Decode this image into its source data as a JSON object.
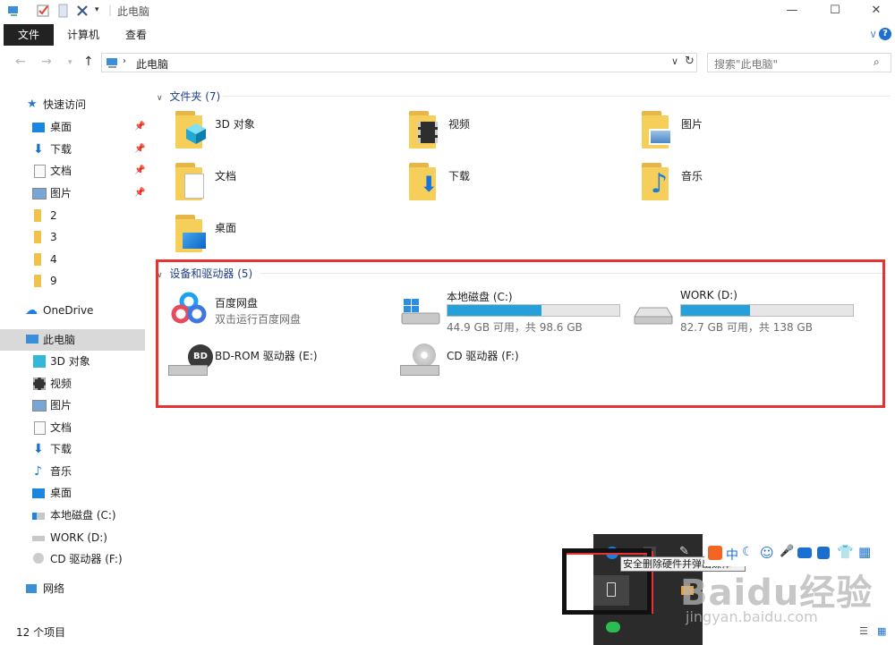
{
  "window": {
    "title": "此电脑",
    "controls": {
      "minimize": "—",
      "maximize": "☐",
      "close": "✕"
    }
  },
  "ribbon": {
    "tabs": [
      "文件",
      "计算机",
      "查看"
    ],
    "collapse": "∨",
    "help": "?"
  },
  "address": {
    "path": "此电脑",
    "search_placeholder": "搜索\"此电脑\""
  },
  "nav": {
    "quick_access": "快速访问",
    "quick_items": [
      "桌面",
      "下载",
      "文档",
      "图片",
      "2",
      "3",
      "4",
      "9"
    ],
    "onedrive": "OneDrive",
    "this_pc": "此电脑",
    "pc_items": [
      "3D 对象",
      "视频",
      "图片",
      "文档",
      "下载",
      "音乐",
      "桌面",
      "本地磁盘 (C:)",
      "WORK (D:)",
      "CD 驱动器 (F:)"
    ],
    "network": "网络"
  },
  "folders": {
    "header": "文件夹 (7)",
    "items": [
      "3D 对象",
      "视频",
      "图片",
      "文档",
      "下载",
      "音乐",
      "桌面"
    ]
  },
  "devices": {
    "header": "设备和驱动器 (5)",
    "baidu": {
      "name": "百度网盘",
      "sub": "双击运行百度网盘"
    },
    "c": {
      "name": "本地磁盘 (C:)",
      "info": "44.9 GB 可用，共 98.6 GB",
      "used_fraction": 0.545
    },
    "d": {
      "name": "WORK (D:)",
      "info": "82.7 GB 可用，共 138 GB",
      "used_fraction": 0.4
    },
    "e": {
      "name": "BD-ROM 驱动器 (E:)",
      "badge": "BD"
    },
    "f": {
      "name": "CD 驱动器 (F:)"
    }
  },
  "status": {
    "count": "12 个项目"
  },
  "tray": {
    "tooltip": "安全删除硬件并弹出媒体"
  },
  "ime": {
    "lang": "中"
  },
  "watermark": {
    "logo": "Baidu经验",
    "url": "jingyan.baidu.com"
  },
  "colors": {
    "accent": "#26a0da",
    "highlight": "#e53333",
    "section": "#1e3f8a"
  }
}
